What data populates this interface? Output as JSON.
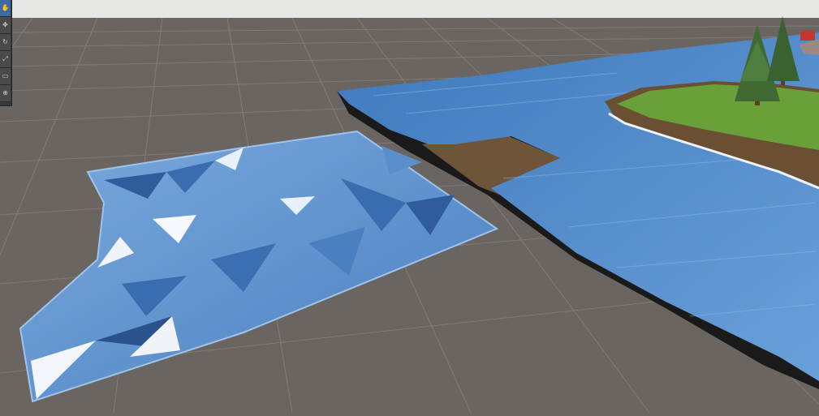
{
  "scene": {
    "sky_color": "#e7e8e6",
    "ground_color": "#6a6560",
    "grid_color": "#8a857f",
    "water_light": "#6fa1d8",
    "water_dark": "#2f5d9c",
    "terrain_brown": "#6e5539",
    "grass_color": "#6aa03a",
    "tree_color": "#3f6a33"
  },
  "toolstrip": {
    "tools": [
      {
        "name": "view-tool",
        "icon": "hand-icon",
        "glyph": "✋"
      },
      {
        "name": "move-tool",
        "icon": "move-icon",
        "glyph": "✥"
      },
      {
        "name": "rotate-tool",
        "icon": "rotate-icon",
        "glyph": "↻"
      },
      {
        "name": "scale-tool",
        "icon": "scale-icon",
        "glyph": "⤢"
      },
      {
        "name": "rect-tool",
        "icon": "rect-icon",
        "glyph": "▭"
      },
      {
        "name": "transform-tool",
        "icon": "transform-icon",
        "glyph": "⊕"
      }
    ],
    "active_index": 0
  }
}
